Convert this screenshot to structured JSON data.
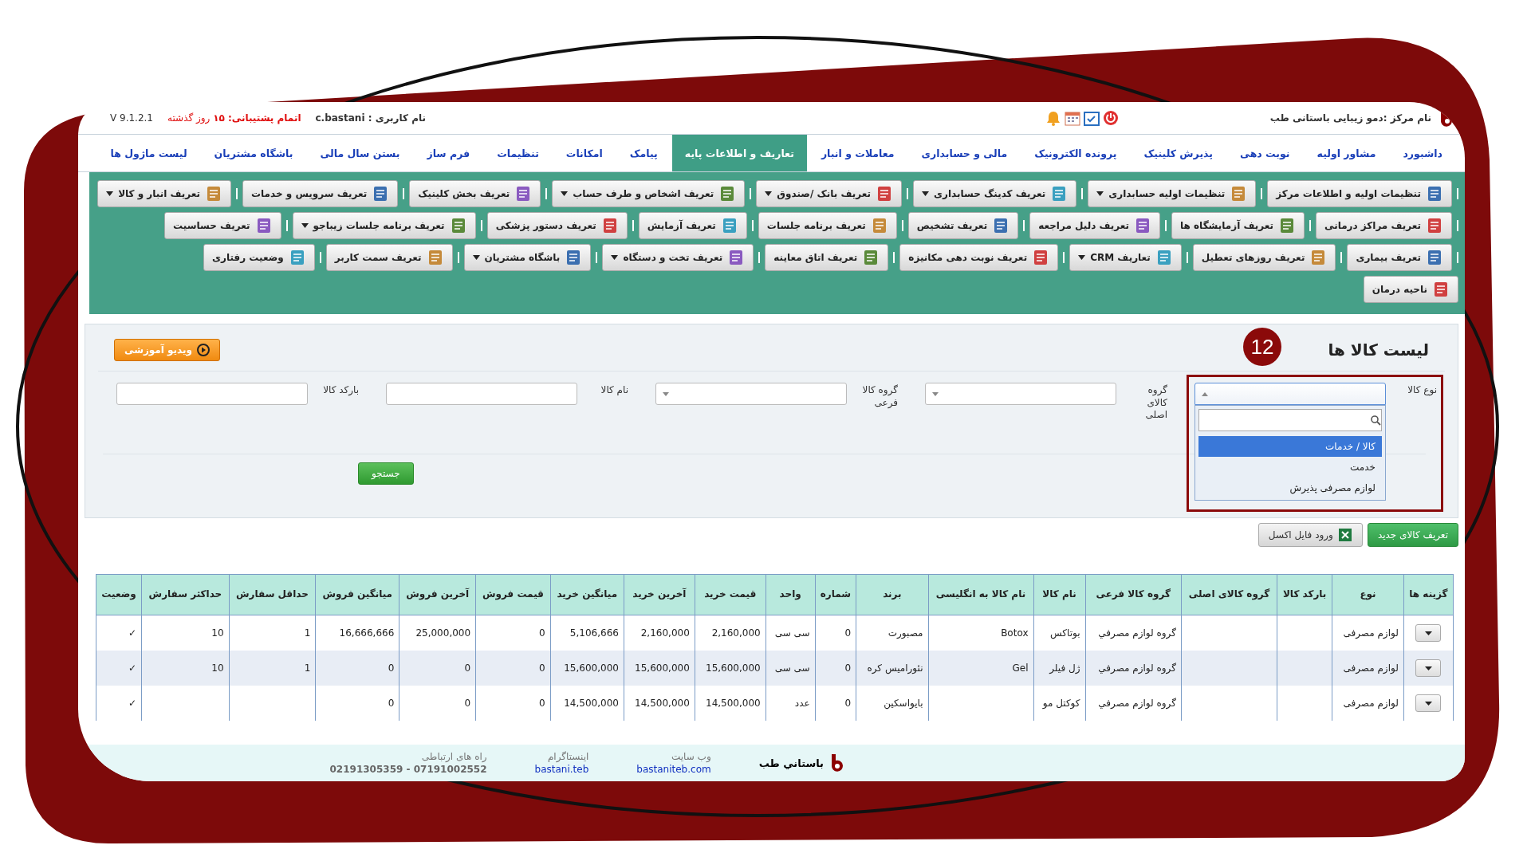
{
  "header": {
    "center": "نام مرکز :دمو زیبایی باستانی طب",
    "user": "نام کاربری : c.bastani",
    "support": "**اتمام پشتیبانی: ۱۵** روز گذشته",
    "version": "V 9.1.2.1"
  },
  "nav": [
    {
      "label": "داشبورد",
      "selected": false
    },
    {
      "label": "مشاور اولیه",
      "selected": false
    },
    {
      "label": "نوبت دهی",
      "selected": false
    },
    {
      "label": "پذیرش کلینیک",
      "selected": false
    },
    {
      "label": "پرونده الکترونیک",
      "selected": false
    },
    {
      "label": "مالی و حسابداری",
      "selected": false
    },
    {
      "label": "معاملات و انبار",
      "selected": false
    },
    {
      "label": "تعاریف و اطلاعات پایه",
      "selected": true
    },
    {
      "label": "پیامک",
      "selected": false
    },
    {
      "label": "امکانات",
      "selected": false
    },
    {
      "label": "تنظیمات",
      "selected": false
    },
    {
      "label": "فرم ساز",
      "selected": false
    },
    {
      "label": "بستن سال مالی",
      "selected": false
    },
    {
      "label": "باشگاه مشتریان",
      "selected": false
    },
    {
      "label": "لیست ماژول ها",
      "selected": false
    }
  ],
  "toolbar": {
    "lines": [
      {
        "buttons": [
          {
            "label": "تنظیمات اولیه و اطلاعات مرکز",
            "has_menu": false
          },
          {
            "label": "تنظیمات اولیه حسابداری",
            "has_menu": true
          },
          {
            "label": "تعریف کدینگ حسابداری",
            "has_menu": true
          },
          {
            "label": "تعریف بانک /صندوق",
            "has_menu": true
          },
          {
            "label": "تعریف اشخاص و طرف حساب",
            "has_menu": true
          },
          {
            "label": "تعریف بخش کلینیک",
            "has_menu": false
          },
          {
            "label": "تعریف سرویس و خدمات",
            "has_menu": false
          },
          {
            "label": "تعریف انبار و کالا",
            "has_menu": true
          }
        ]
      },
      {
        "buttons": [
          {
            "label": "تعریف مراکز درمانی",
            "has_menu": false
          },
          {
            "label": "تعریف آزمایشگاه ها",
            "has_menu": false
          },
          {
            "label": "تعریف دلیل مراجعه",
            "has_menu": false
          },
          {
            "label": "تعریف تشخیص",
            "has_menu": false
          },
          {
            "label": "تعریف برنامه جلسات",
            "has_menu": false
          },
          {
            "label": "تعریف آزمایش",
            "has_menu": false
          },
          {
            "label": "تعریف دستور پزشکی",
            "has_menu": false
          },
          {
            "label": "تعریف برنامه جلسات زیباجو",
            "has_menu": true
          },
          {
            "label": "تعریف حساسیت",
            "has_menu": false
          }
        ]
      },
      {
        "buttons": [
          {
            "label": "تعریف بیماری",
            "has_menu": false
          },
          {
            "label": "تعریف روزهای تعطیل",
            "has_menu": false
          },
          {
            "label": "تعاریف CRM",
            "has_menu": true
          },
          {
            "label": "تعریف نوبت دهی مکانیزه",
            "has_menu": false
          },
          {
            "label": "تعریف اتاق معاینه",
            "has_menu": false
          },
          {
            "label": "تعریف تخت و دستگاه",
            "has_menu": true
          },
          {
            "label": "باشگاه مشتریان",
            "has_menu": true
          },
          {
            "label": "تعریف سمت کاربر",
            "has_menu": false
          },
          {
            "label": "وضعیت رفتاری",
            "has_menu": false
          }
        ]
      },
      {
        "buttons": [
          {
            "label": "ناحیه درمان",
            "has_menu": false
          }
        ]
      }
    ]
  },
  "page": {
    "title": "لیست کالا ها",
    "video_button": "ویدیو آموزشی"
  },
  "annotation": {
    "number": "12"
  },
  "filters": [
    {
      "label": "نوع کالا",
      "kind": "select",
      "expanded": true,
      "options": [
        {
          "label": "کالا / خدمات",
          "selected": true
        },
        {
          "label": "خدمت",
          "selected": false
        },
        {
          "label": "لوازم مصرفی پذیرش",
          "selected": false
        }
      ]
    },
    {
      "label": "گروه کالای اصلی",
      "kind": "select",
      "expanded": false
    },
    {
      "label": "گروه کالا فرعی",
      "kind": "select",
      "expanded": false
    },
    {
      "label": "نام کالا",
      "kind": "input"
    },
    {
      "label": "بارکد کالا",
      "kind": "input"
    }
  ],
  "search_button": "جستجو",
  "actions": [
    {
      "label": "تعریف کالای جدید",
      "kind": "primary"
    },
    {
      "label": "ورود فایل اکسل",
      "kind": "excel"
    }
  ],
  "table": {
    "columns": [
      "گزینه ها",
      "نوع",
      "بارکد کالا",
      "گروه کالای اصلی",
      "گروه کالا فرعی",
      "نام کالا",
      "نام کالا به انگلیسی",
      "برند",
      "شماره",
      "واحد",
      "قیمت خرید",
      "آخرین خرید",
      "میانگین خرید",
      "قیمت فروش",
      "آخرین فروش",
      "میانگین فروش",
      "حداقل سفارش",
      "حداکثر سفارش",
      "وضعیت"
    ],
    "rows": [
      [
        null,
        "لوازم مصرفی",
        null,
        null,
        "گروه لوازم مصرفي",
        "بوتاکس",
        "Botox",
        "مصبورت",
        "0",
        "سی سی",
        "2,160,000",
        "2,160,000",
        "5,106,666",
        "0",
        "25,000,000",
        "16,666,666",
        "1",
        "10",
        "✓"
      ],
      [
        null,
        "لوازم مصرفی",
        null,
        null,
        "گروه لوازم مصرفي",
        "ژل فیلر",
        "Gel",
        "نئورامیس کره",
        "0",
        "سی سی",
        "15,600,000",
        "15,600,000",
        "15,600,000",
        "0",
        "0",
        "0",
        "1",
        "10",
        "✓"
      ],
      [
        null,
        "لوازم مصرفی",
        null,
        null,
        "گروه لوازم مصرفي",
        "کوکتل مو",
        null,
        "بایواسکین",
        "0",
        "عدد",
        "14,500,000",
        "14,500,000",
        "14,500,000",
        "0",
        "0",
        "0",
        null,
        null,
        "✓"
      ]
    ]
  },
  "footer": {
    "brand": "باستاني طب",
    "links": [
      {
        "label": "وب سایت",
        "value": "bastaniteb.com",
        "kind": "link"
      },
      {
        "label": "اینستاگرام",
        "value": "bastani.teb",
        "kind": "link"
      },
      {
        "label": "راه های ارتباطی",
        "value": "07191002552 - 02191305359",
        "kind": "text"
      }
    ]
  }
}
